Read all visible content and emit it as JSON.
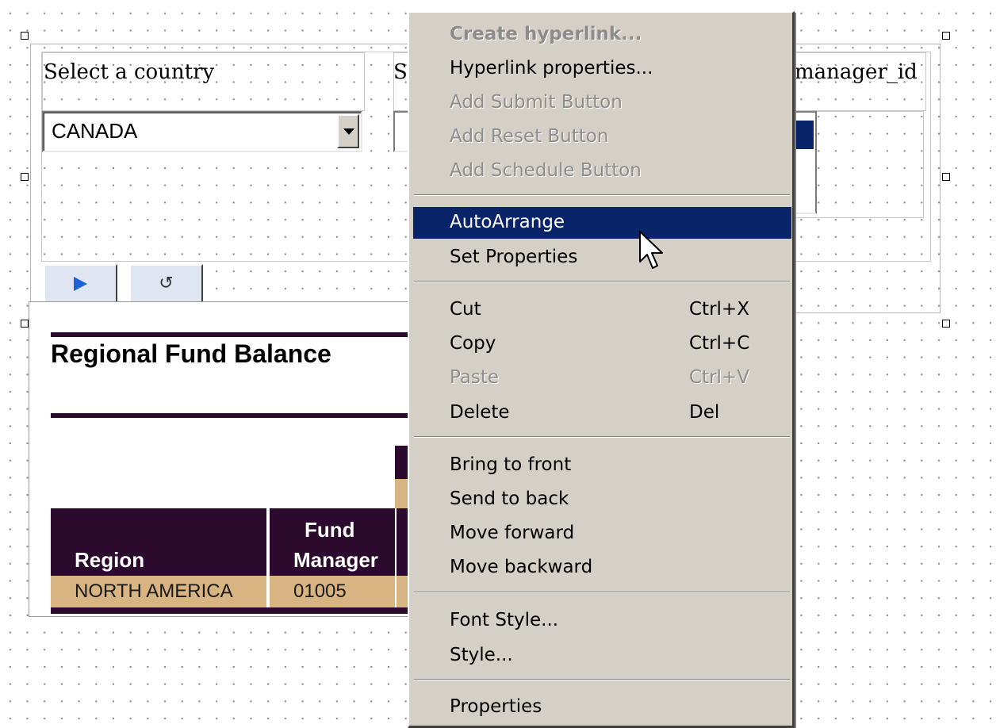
{
  "parameter_form": {
    "country_label": "Select a country",
    "country_value": "CANADA",
    "second_label": "S",
    "third_label": "manager_id"
  },
  "report": {
    "title": "Regional Fund Balance",
    "columns": [
      "Region",
      "Fund",
      "Manager"
    ],
    "rows": [
      [
        "NORTH AMERICA",
        "01005"
      ]
    ]
  },
  "context_menu": {
    "items": [
      {
        "label": "Create hyperlink...",
        "state": "disabled-bold"
      },
      {
        "label": "Hyperlink properties...",
        "state": "enabled"
      },
      {
        "label": "Add Submit Button",
        "state": "disabled"
      },
      {
        "label": "Add Reset Button",
        "state": "disabled"
      },
      {
        "label": "Add Schedule Button",
        "state": "disabled"
      },
      {
        "label": "AutoArrange",
        "state": "selected"
      },
      {
        "label": "Set Properties",
        "state": "enabled"
      },
      {
        "label": "Cut",
        "shortcut": "Ctrl+X",
        "state": "enabled"
      },
      {
        "label": "Copy",
        "shortcut": "Ctrl+C",
        "state": "enabled"
      },
      {
        "label": "Paste",
        "shortcut": "Ctrl+V",
        "state": "disabled"
      },
      {
        "label": "Delete",
        "shortcut": "Del",
        "state": "enabled"
      },
      {
        "label": "Bring to front",
        "state": "enabled"
      },
      {
        "label": "Send to back",
        "state": "enabled"
      },
      {
        "label": "Move forward",
        "state": "enabled"
      },
      {
        "label": "Move backward",
        "state": "enabled"
      },
      {
        "label": "Font Style...",
        "state": "enabled"
      },
      {
        "label": "Style...",
        "state": "enabled"
      },
      {
        "label": "Properties",
        "state": "enabled"
      }
    ]
  },
  "colors": {
    "menu_bg": "#d4d0c8",
    "selection": "#0a246a",
    "report_header": "#2b0a2e",
    "report_row": "#d8b483",
    "run_icon": "#1d63d8"
  },
  "icons": [
    "run-icon",
    "reset-icon",
    "dropdown-arrow-icon",
    "mouse-pointer-icon"
  ]
}
